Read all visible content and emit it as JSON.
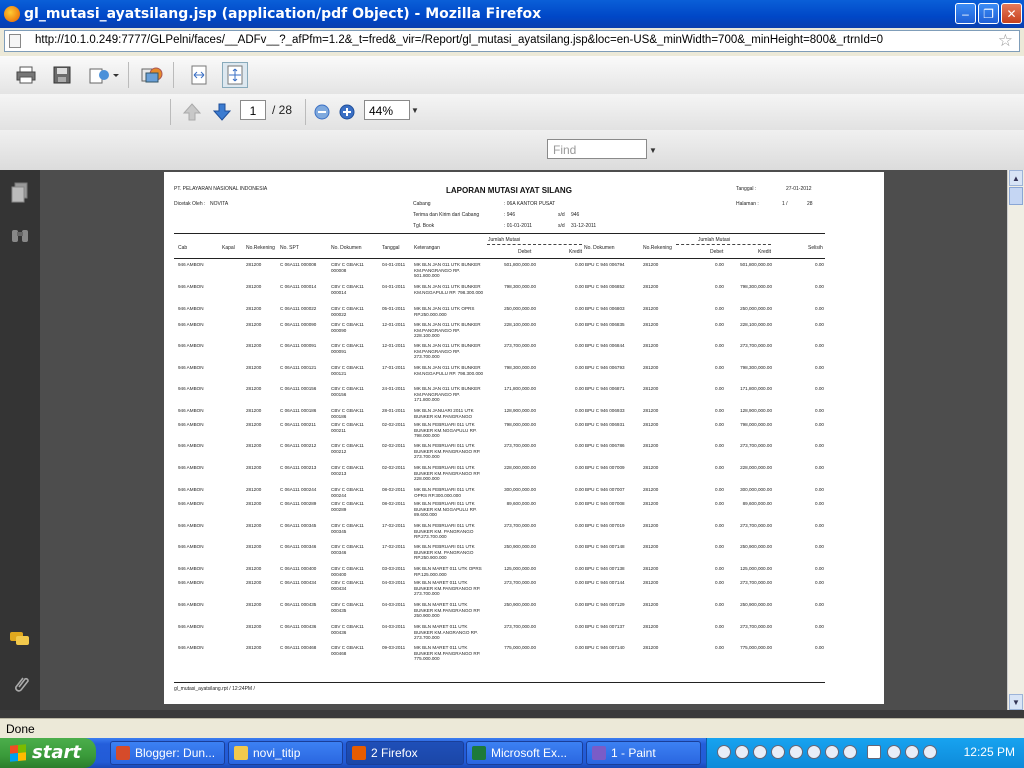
{
  "window": {
    "title": "gl_mutasi_ayatsilang.jsp (application/pdf Object) - Mozilla Firefox",
    "url": "http://10.1.0.249:7777/GLPelni/faces/__ADFv__?_afPfm=1.2&_t=fred&_vir=/Report/gl_mutasi_ayatsilang.jsp&loc=en-US&_minWidth=700&_minHeight=800&_rtrnId=0"
  },
  "pdf": {
    "page_current": "1",
    "page_total": "/ 28",
    "zoom": "44%",
    "find_placeholder": "Find"
  },
  "report": {
    "company": "PT. PELAYARAN NASIONAL INDONESIA",
    "printed_by_label": "Dicetak Oleh :",
    "printed_by": "NOVITA",
    "title": "LAPORAN MUTASI AYAT SILANG",
    "cabang_label": "Cabang",
    "cabang_value": ":  06A   KANTOR PUSAT",
    "terima_label": "Terima dan Kirim dari Cabang",
    "terima_value": ":  946",
    "terima_sd": "s/d",
    "terima_to": "946",
    "tgl_book_label": "Tgl. Book",
    "tgl_book_value": ":  01-01-2011",
    "tgl_sd": "s/d",
    "tgl_to": "31-12-2011",
    "tanggal_label": "Tanggal  :",
    "tanggal_value": "27-01-2012",
    "halaman_label": "Halaman  :",
    "halaman_value": "1   /",
    "halaman_total": "28",
    "headers": {
      "cab": "Cab",
      "kapal": "Kapal",
      "norek": "No.Rekening",
      "nospt": "No. SPT",
      "nodok": "No. Dokumen",
      "tanggal": "Tanggal",
      "ket": "Keterangan",
      "jumlah1": "Jumlah Mutasi",
      "debet1": "Debet",
      "kredit1": "Kredit",
      "nodok2": "No. Dokumen",
      "norek2": "No.Rekening",
      "jumlah2": "Jumlah Mutasi",
      "debet2": "Debet",
      "kredit2": "Kredit",
      "selisih": "Selisih"
    },
    "rows": [
      {
        "cab": "946 AMBON",
        "norek": "281200",
        "spt": "C 06A111 000008",
        "dok": "CBV C GBAK11 000008",
        "tgl": "04-01-2011",
        "ket": "MK BLN JAN 011 UTK BUNKER KM.PANGRANGO RP. 501.800.000",
        "debet": "501,800,000.00",
        "kredit": "0.00",
        "dok2": "BPU C 946 006794",
        "norek2": "281200",
        "debet2": "0.00",
        "kredit2": "501,800,000.00",
        "selisih": "0.00"
      },
      {
        "cab": "946 AMBON",
        "norek": "281200",
        "spt": "C 06A111 000014",
        "dok": "CBV C GBAK11 000014",
        "tgl": "04-01-2011",
        "ket": "MK BLN JAN 011 UTK BUNKER KM.NGGAPULU RP. 798.300.000",
        "debet": "798,300,000.00",
        "kredit": "0.00",
        "dok2": "BPU C 946 006852",
        "norek2": "281200",
        "debet2": "0.00",
        "kredit2": "798,300,000.00",
        "selisih": "0.00"
      },
      {
        "cab": "946 AMBON",
        "norek": "281200",
        "spt": "C 06A111 000022",
        "dok": "CBV C GBAK11 000022",
        "tgl": "05-01-2011",
        "ket": "MK BLN JAN 011 UTK OPRS RP.250.000.000",
        "debet": "250,000,000.00",
        "kredit": "0.00",
        "dok2": "BPU C 946 006803",
        "norek2": "281200",
        "debet2": "0.00",
        "kredit2": "250,000,000.00",
        "selisih": "0.00"
      },
      {
        "cab": "946 AMBON",
        "norek": "281200",
        "spt": "C 06A111 000090",
        "dok": "CBV C GBAK11 000090",
        "tgl": "12-01-2011",
        "ket": "MK BLN JAN 011 UTK BUNKER KM.PANGRANGO RP. 228.100.000",
        "debet": "228,100,000.00",
        "kredit": "0.00",
        "dok2": "BPU C 946 006835",
        "norek2": "281200",
        "debet2": "0.00",
        "kredit2": "228,100,000.00",
        "selisih": "0.00"
      },
      {
        "cab": "946 AMBON",
        "norek": "281200",
        "spt": "C 06A111 000091",
        "dok": "CBV C GBAK11 000091",
        "tgl": "12-01-2011",
        "ket": "MK BLN JAN 011 UTK BUNKER KM.PANGRANGO RP. 273.700.000",
        "debet": "273,700,000.00",
        "kredit": "0.00",
        "dok2": "BPU C 946 006844",
        "norek2": "281200",
        "debet2": "0.00",
        "kredit2": "273,700,000.00",
        "selisih": "0.00"
      },
      {
        "cab": "946 AMBON",
        "norek": "281200",
        "spt": "C 06A111 000121",
        "dok": "CBV C GBAK11 000121",
        "tgl": "17-01-2011",
        "ket": "MK BLN JAN 011 UTK BUNKER KM.NGGAPULU RP. 798.300.000",
        "debet": "798,300,000.00",
        "kredit": "0.00",
        "dok2": "BPU C 946 006793",
        "norek2": "281200",
        "debet2": "0.00",
        "kredit2": "798,300,000.00",
        "selisih": "0.00"
      },
      {
        "cab": "946 AMBON",
        "norek": "281200",
        "spt": "C 06A111 000156",
        "dok": "CBV C GBAK11 000156",
        "tgl": "24-01-2011",
        "ket": "MK BLN JAN 011 UTK BUNKER KM.PANGRANGO RP. 171.800.000",
        "debet": "171,800,000.00",
        "kredit": "0.00",
        "dok2": "BPU C 946 006871",
        "norek2": "281200",
        "debet2": "0.00",
        "kredit2": "171,800,000.00",
        "selisih": "0.00"
      },
      {
        "cab": "946 AMBON",
        "norek": "281200",
        "spt": "C 06A111 000186",
        "dok": "CBV C GBAK11 000186",
        "tgl": "28-01-2011",
        "ket": "MK BLN JANUARI 2011 UTK BUNKER KM.PANGRANGO",
        "debet": "128,900,000.00",
        "kredit": "0.00",
        "dok2": "BPU C 946 006933",
        "norek2": "281200",
        "debet2": "0.00",
        "kredit2": "128,900,000.00",
        "selisih": "0.00"
      },
      {
        "cab": "946 AMBON",
        "norek": "281200",
        "spt": "C 06A111 000211",
        "dok": "CBV C GBAK11 000211",
        "tgl": "02-02-2011",
        "ket": "MK BLN FEBRUARI 011 UTK BUNKER KM.NGGAPULU RP. 798.000.000",
        "debet": "798,000,000.00",
        "kredit": "0.00",
        "dok2": "BPU C 946 006931",
        "norek2": "281200",
        "debet2": "0.00",
        "kredit2": "798,000,000.00",
        "selisih": "0.00"
      },
      {
        "cab": "946 AMBON",
        "norek": "281200",
        "spt": "C 06A111 000212",
        "dok": "CBV C GBAK11 000212",
        "tgl": "02-02-2011",
        "ket": "MK BLN FEBRUARI 011 UTK BUNKER KM.PANGRANGO RP. 273.700.000",
        "debet": "273,700,000.00",
        "kredit": "0.00",
        "dok2": "BPU C 946 006786",
        "norek2": "281200",
        "debet2": "0.00",
        "kredit2": "273,700,000.00",
        "selisih": "0.00"
      },
      {
        "cab": "946 AMBON",
        "norek": "281200",
        "spt": "C 06A111 000213",
        "dok": "CBV C GBAK11 000213",
        "tgl": "02-02-2011",
        "ket": "MK BLN FEBRUARI 011 UTK BUNKER KM.PANGRANGO RP. 228.000.000",
        "debet": "228,000,000.00",
        "kredit": "0.00",
        "dok2": "BPU C 946 007009",
        "norek2": "281200",
        "debet2": "0.00",
        "kredit2": "228,000,000.00",
        "selisih": "0.00"
      },
      {
        "cab": "946 AMBON",
        "norek": "281200",
        "spt": "C 06A111 000244",
        "dok": "CBV C GBAK11 000244",
        "tgl": "08-02-2011",
        "ket": "MK BLN FEBRUARI 011 UTK OPRS RP.300.000.000",
        "debet": "300,000,000.00",
        "kredit": "0.00",
        "dok2": "BPU C 946 007007",
        "norek2": "281200",
        "debet2": "0.00",
        "kredit2": "300,000,000.00",
        "selisih": "0.00"
      },
      {
        "cab": "946 AMBON",
        "norek": "281200",
        "spt": "C 06A111 000289",
        "dok": "CBV C GBAK11 000289",
        "tgl": "08-02-2011",
        "ket": "MK BLN FEBRUARI 011 UTK BUNKER KM.NGGAPULU RP. 89.600.000",
        "debet": "89,600,000.00",
        "kredit": "0.00",
        "dok2": "BPU C 946 007008",
        "norek2": "281200",
        "debet2": "0.00",
        "kredit2": "89,600,000.00",
        "selisih": "0.00"
      },
      {
        "cab": "946 AMBON",
        "norek": "281200",
        "spt": "C 06A111 000345",
        "dok": "CBV C GBAK11 000345",
        "tgl": "17-02-2011",
        "ket": "MK BLN FEBRUARI 011 UTK BUNKER KM. PANGRANGO RP.273.700.000",
        "debet": "273,700,000.00",
        "kredit": "0.00",
        "dok2": "BPU C 946 007019",
        "norek2": "281200",
        "debet2": "0.00",
        "kredit2": "273,700,000.00",
        "selisih": "0.00"
      },
      {
        "cab": "946 AMBON",
        "norek": "281200",
        "spt": "C 06A111 000346",
        "dok": "CBV C GBAK11 000346",
        "tgl": "17-02-2011",
        "ket": "MK BLN FEBRUARI 011 UTK BUNKER KM. PANGRANGO RP.250.900.000",
        "debet": "250,900,000.00",
        "kredit": "0.00",
        "dok2": "BPU C 946 007148",
        "norek2": "281200",
        "debet2": "0.00",
        "kredit2": "250,900,000.00",
        "selisih": "0.00"
      },
      {
        "cab": "946 AMBON",
        "norek": "281200",
        "spt": "C 06A111 000400",
        "dok": "CBV C GBAK11 000400",
        "tgl": "03-03-2011",
        "ket": "MK BLN MARET 011 UTK OPRS RP.125.000.000",
        "debet": "125,000,000.00",
        "kredit": "0.00",
        "dok2": "BPU C 946 007138",
        "norek2": "281200",
        "debet2": "0.00",
        "kredit2": "125,000,000.00",
        "selisih": "0.00"
      },
      {
        "cab": "946 AMBON",
        "norek": "281200",
        "spt": "C 06A111 000434",
        "dok": "CBV C GBAK11 000434",
        "tgl": "04-03-2011",
        "ket": "MK BLN MARET 011 UTK BUNKER KM.PANGRANGO RP. 273.700.000",
        "debet": "273,700,000.00",
        "kredit": "0.00",
        "dok2": "BPU C 946 007144",
        "norek2": "281200",
        "debet2": "0.00",
        "kredit2": "273,700,000.00",
        "selisih": "0.00"
      },
      {
        "cab": "946 AMBON",
        "norek": "281200",
        "spt": "C 06A111 000435",
        "dok": "CBV C GBAK11 000435",
        "tgl": "04-03-2011",
        "ket": "MK BLN MARET 011 UTK BUNKER KM.PANGRANGO RP. 250.900.000",
        "debet": "250,900,000.00",
        "kredit": "0.00",
        "dok2": "BPU C 946 007129",
        "norek2": "281200",
        "debet2": "0.00",
        "kredit2": "250,900,000.00",
        "selisih": "0.00"
      },
      {
        "cab": "946 AMBON",
        "norek": "281200",
        "spt": "C 06A111 000436",
        "dok": "CBV C GBAK11 000436",
        "tgl": "04-03-2011",
        "ket": "MK BLN MARET 011 UTK BUNKER KM.ANGRANGO RP. 273.700.000",
        "debet": "273,700,000.00",
        "kredit": "0.00",
        "dok2": "BPU C 946 007137",
        "norek2": "281200",
        "debet2": "0.00",
        "kredit2": "273,700,000.00",
        "selisih": "0.00"
      },
      {
        "cab": "946 AMBON",
        "norek": "281200",
        "spt": "C 06A111 000468",
        "dok": "CBV C GBAK11 000468",
        "tgl": "09-03-2011",
        "ket": "MK BLN MARET 011 UTK BUNKER KM.PANGRANGO RP. 775.000.000",
        "debet": "775,000,000.00",
        "kredit": "0.00",
        "dok2": "BPU C 946 007140",
        "norek2": "281200",
        "debet2": "0.00",
        "kredit2": "775,000,000.00",
        "selisih": "0.00"
      }
    ],
    "footer": "gl_mutasi_ayatsilang.rpt   / 12:24PM    /"
  },
  "status": "Done",
  "taskbar": {
    "start": "start",
    "tasks": [
      {
        "label": "Blogger: Dun...",
        "color": "#d64b2a"
      },
      {
        "label": "novi_titip",
        "color": "#f2c94c"
      },
      {
        "label": "2 Firefox",
        "color": "#e65c00"
      },
      {
        "label": "Microsoft Ex...",
        "color": "#1d7a3a"
      },
      {
        "label": "1 - Paint",
        "color": "#7a5cc7"
      }
    ],
    "clock": "12:25 PM"
  }
}
